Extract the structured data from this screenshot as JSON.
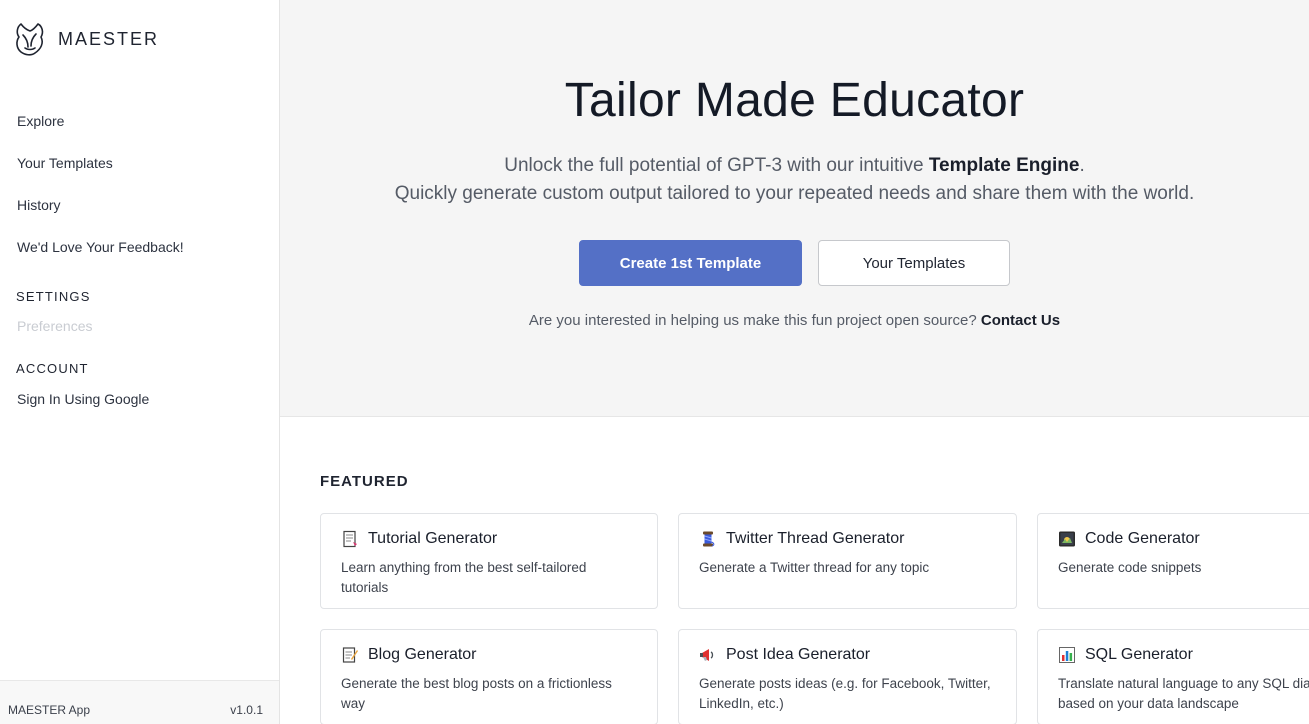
{
  "brand": {
    "name": "MAESTER"
  },
  "sidebar": {
    "nav": [
      {
        "label": "Explore"
      },
      {
        "label": "Your Templates"
      },
      {
        "label": "History"
      },
      {
        "label": "We'd Love Your Feedback!"
      }
    ],
    "settings": {
      "title": "SETTINGS",
      "items": [
        {
          "label": "Preferences"
        }
      ]
    },
    "account": {
      "title": "ACCOUNT",
      "items": [
        {
          "label": "Sign In Using Google"
        }
      ]
    },
    "footer": {
      "app_name": "MAESTER App",
      "version": "v1.0.1"
    }
  },
  "hero": {
    "title": "Tailor Made Educator",
    "subtitle_prefix": "Unlock the full potential of GPT-3 with our intuitive ",
    "subtitle_bold": "Template Engine",
    "subtitle_suffix": ".",
    "subtitle_line2": "Quickly generate custom output tailored to your repeated needs and share them with the world.",
    "primary_button": "Create 1st Template",
    "secondary_button": "Your Templates",
    "contact_prompt": "Are you interested in helping us make this fun project open source?",
    "contact_link": "Contact Us"
  },
  "featured": {
    "title": "FEATURED",
    "cards": [
      {
        "title": "Tutorial Generator",
        "description": "Learn anything from the best self-tailored tutorials",
        "icon": "page-icon"
      },
      {
        "title": "Twitter Thread Generator",
        "description": "Generate a Twitter thread for any topic",
        "icon": "spool-icon"
      },
      {
        "title": "Code Generator",
        "description": "Generate code snippets",
        "icon": "code-screen-icon"
      },
      {
        "title": "Blog Generator",
        "description": "Generate the best blog posts on a frictionless way",
        "icon": "memo-icon"
      },
      {
        "title": "Post Idea Generator",
        "description": "Generate posts ideas (e.g. for Facebook, Twitter, LinkedIn, etc.)",
        "icon": "megaphone-icon"
      },
      {
        "title": "SQL Generator",
        "description": "Translate natural language to any SQL dialect based on your data landscape",
        "icon": "bar-chart-icon"
      }
    ]
  }
}
